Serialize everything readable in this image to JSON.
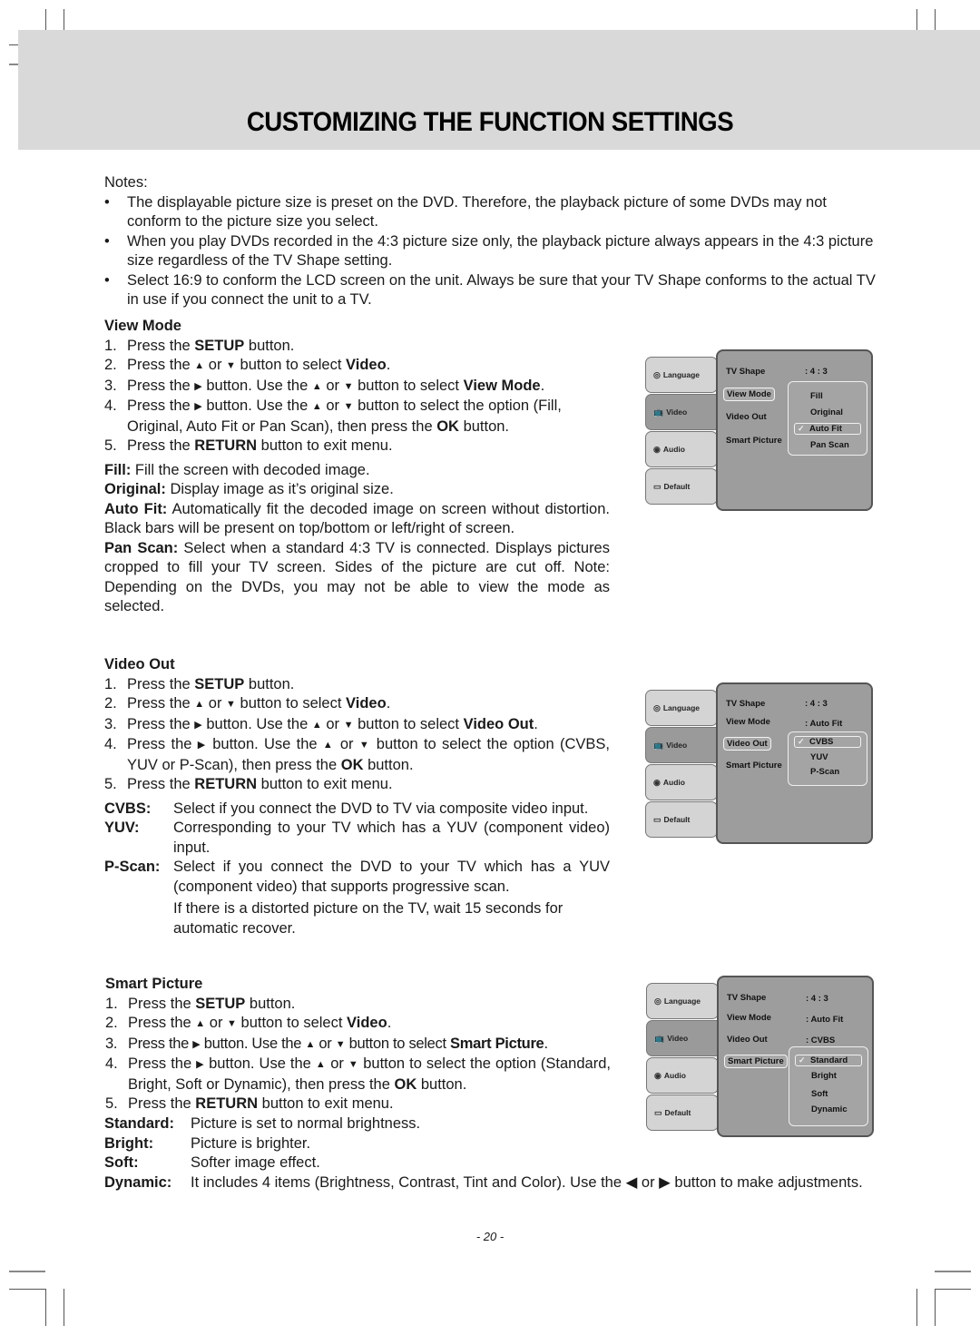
{
  "page": {
    "title": "CUSTOMIZING THE FUNCTION SETTINGS",
    "page_number": "- 20 -"
  },
  "notes": {
    "heading": "Notes:",
    "bullets": [
      "The displayable picture size is preset on the DVD. Therefore, the playback picture of some DVDs may not conform to the picture size you select.",
      "When you play DVDs recorded in the 4:3 picture size only, the playback picture always appears in the 4:3 picture size regardless of the TV Shape setting.",
      "Select 16:9 to conform the LCD screen on the unit. Always be sure that your TV Shape conforms to the actual TV in use if you connect the unit to a TV."
    ]
  },
  "common": {
    "press_the": "Press the",
    "setup": "SETUP",
    "button_dot": "button.",
    "or": "or",
    "button_to_select": "button to select",
    "video": "Video",
    "button_use_the": "button. Use the",
    "button_to_select_the_option": "button to select the option",
    "then_press_the": "then press the",
    "ok": "OK",
    "return": "RETURN",
    "button_to_exit_menu": "button to exit menu.",
    "up": "▲",
    "down": "▼",
    "right": "▶",
    "left": "◀"
  },
  "view_mode": {
    "heading": "View Mode",
    "target": "View Mode",
    "options_text_a": "(Fill,",
    "options_text_b": "Original, Auto Fit or Pan Scan),",
    "defs": [
      {
        "term": "Fill:",
        "text": "Fill the screen with decoded image."
      },
      {
        "term": "Original:",
        "text": "Display image as it’s original size."
      },
      {
        "term": "Auto Fit:",
        "text": "Automatically fit the decoded image on screen without distortion. Black bars will be present on top/bottom or left/right of screen."
      },
      {
        "term": "Pan Scan:",
        "text": "Select when a standard 4:3 TV is connected. Displays pictures cropped to fill your TV screen. Sides of the picture are cut off. Note: Depending on the DVDs, you may not be able to view the mode as selected."
      }
    ]
  },
  "video_out": {
    "heading": "Video Out",
    "target": "Video Out",
    "options_text": "(CVBS, YUV or P-Scan),",
    "defs": [
      {
        "term": "CVBS:",
        "text": "Select if you connect the DVD to TV via composite video input."
      },
      {
        "term": "YUV:",
        "text": "Corresponding to your TV which has a YUV (component video) input."
      },
      {
        "term": "P-Scan:",
        "text": "Select if you connect the DVD to your TV which has a YUV (component video) that supports progressive scan."
      }
    ],
    "extra_note": "If there is a distorted picture on the TV, wait 15 seconds for automatic recover."
  },
  "smart_picture": {
    "heading": "Smart Picture",
    "target": "Smart Picture",
    "options_text": "(Standard, Bright, Soft or Dynamic),",
    "defs": [
      {
        "term": "Standard:",
        "text": "Picture is set to normal brightness."
      },
      {
        "term": "Bright:",
        "text": "Picture is brighter."
      },
      {
        "term": "Soft:",
        "text": "Softer image effect."
      },
      {
        "term": "Dynamic:",
        "text": "It includes 4 items (Brightness, Contrast, Tint and Color). Use the ◀ or ▶ button to make adjustments."
      }
    ]
  },
  "osd": {
    "tabs": [
      "Language",
      "Video",
      "Audio",
      "Default"
    ],
    "items": [
      "TV Shape",
      "View Mode",
      "Video Out",
      "Smart Picture"
    ],
    "menus": [
      {
        "values": {
          "tv_shape": ": 4 : 3"
        },
        "options": [
          "Fill",
          "Original",
          "Auto Fit",
          "Pan Scan"
        ],
        "checked": "Auto Fit"
      },
      {
        "values": {
          "tv_shape": ": 4 : 3",
          "view_mode": ": Auto Fit"
        },
        "options": [
          "CVBS",
          "YUV",
          "P-Scan"
        ],
        "checked": "CVBS"
      },
      {
        "values": {
          "tv_shape": ": 4 : 3",
          "view_mode": ": Auto Fit",
          "video_out": ": CVBS"
        },
        "options": [
          "Standard",
          "Bright",
          "Soft",
          "Dynamic"
        ],
        "checked": "Standard"
      }
    ]
  }
}
